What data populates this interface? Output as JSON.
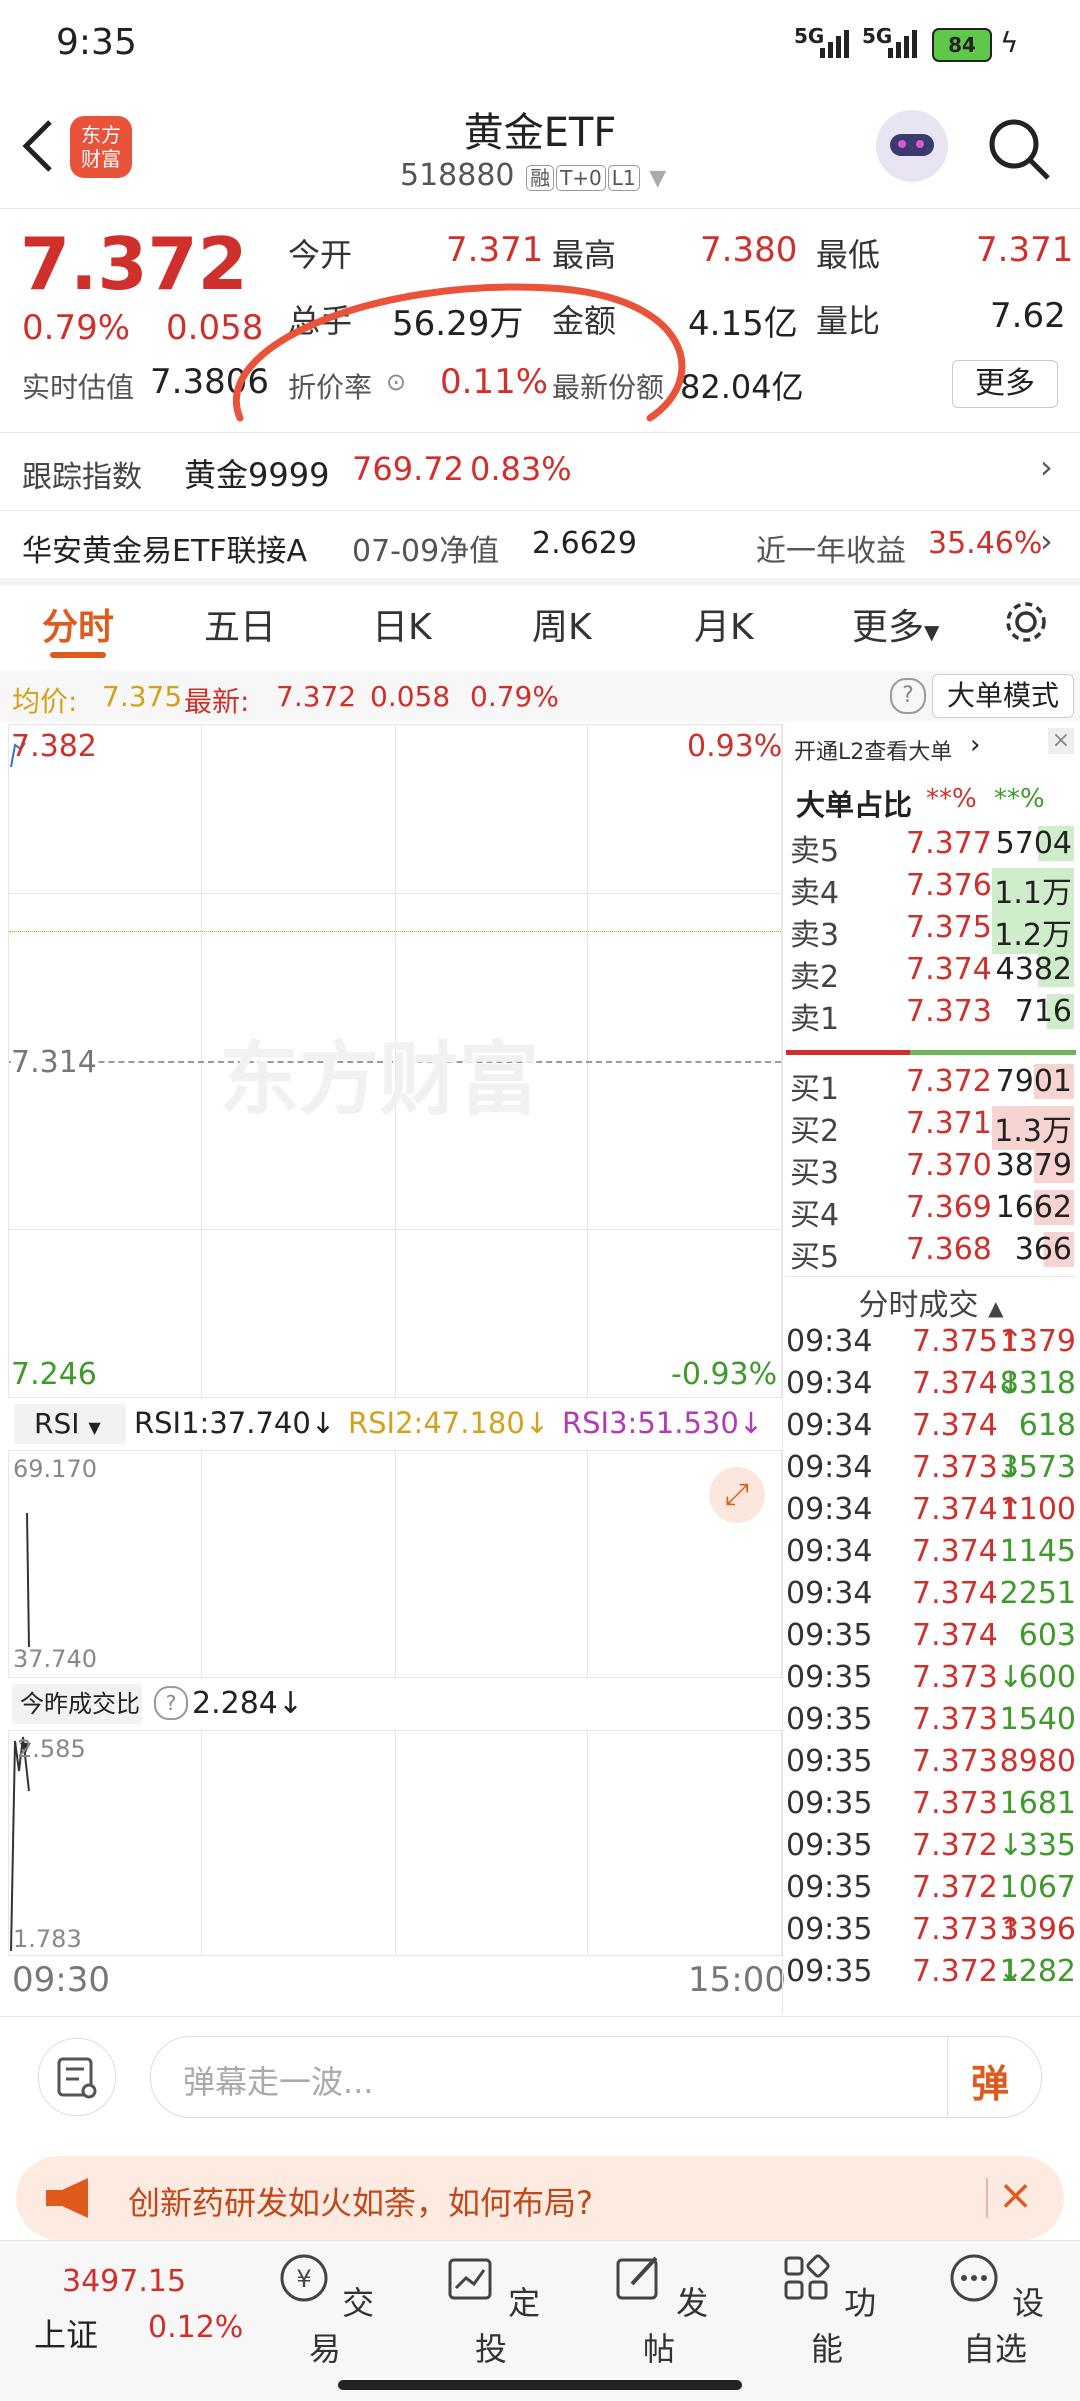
{
  "status_bar": {
    "time": "9:35",
    "network1": "5G",
    "network2": "5G",
    "battery": "84"
  },
  "header": {
    "logo_line1": "东方",
    "logo_line2": "财富",
    "title": "黄金ETF",
    "code": "518880",
    "tags": [
      "融",
      "T+0",
      "L1"
    ]
  },
  "quote": {
    "price": "7.372",
    "change_pct": "0.79%",
    "change": "0.058",
    "open_label": "今开",
    "open": "7.371",
    "high_label": "最高",
    "high": "7.380",
    "low_label": "最低",
    "low": "7.371",
    "volume_label": "总手",
    "volume": "56.29万",
    "amount_label": "金额",
    "amount": "4.15亿",
    "vol_ratio_label": "量比",
    "vol_ratio": "7.62",
    "est_label": "实时估值",
    "est": "7.3806",
    "discount_label": "折价率",
    "discount": "0.11%",
    "shares_label": "最新份额",
    "shares": "82.04亿",
    "more": "更多"
  },
  "tracking": {
    "label": "跟踪指数",
    "name": "黄金9999",
    "value": "769.72",
    "pct": "0.83%"
  },
  "linked": {
    "name": "华安黄金易ETF联接A",
    "date_label": "07-09净值",
    "nav": "2.6629",
    "yr_label": "近一年收益",
    "yr": "35.46%"
  },
  "tabs": [
    "分时",
    "五日",
    "日K",
    "周K",
    "月K",
    "更多"
  ],
  "chart_header": {
    "avg_label": "均价:",
    "avg": "7.375",
    "latest_label": "最新:",
    "latest": "7.372",
    "chg": "0.058",
    "pct": "0.79%",
    "mode": "大单模式"
  },
  "chart": {
    "y_top": "7.382",
    "y_mid": "7.314",
    "y_bot": "7.246",
    "pct_top": "0.93%",
    "pct_bot": "-0.93%",
    "watermark": "东方财富",
    "x_start": "09:30",
    "x_end": "15:00"
  },
  "rsi": {
    "selector": "RSI",
    "rsi1": "RSI1:37.740",
    "rsi2": "RSI2:47.180",
    "rsi3": "RSI3:51.530",
    "y_top": "69.170",
    "y_bot": "37.740"
  },
  "volratio": {
    "selector": "今昨成交比",
    "value": "2.284",
    "y_top": "2.585",
    "y_bot": "1.783"
  },
  "orderbook": {
    "l2_promo": "开通L2查看大单",
    "big_label": "大单占比",
    "big1": "**%",
    "big2": "**%",
    "asks": [
      {
        "label": "卖5",
        "price": "7.377",
        "vol": "5704"
      },
      {
        "label": "卖4",
        "price": "7.376",
        "vol": "1.1万"
      },
      {
        "label": "卖3",
        "price": "7.375",
        "vol": "1.2万"
      },
      {
        "label": "卖2",
        "price": "7.374",
        "vol": "4382"
      },
      {
        "label": "卖1",
        "price": "7.373",
        "vol": "716"
      }
    ],
    "bids": [
      {
        "label": "买1",
        "price": "7.372",
        "vol": "7901"
      },
      {
        "label": "买2",
        "price": "7.371",
        "vol": "1.3万"
      },
      {
        "label": "买3",
        "price": "7.370",
        "vol": "3879"
      },
      {
        "label": "买4",
        "price": "7.369",
        "vol": "1662"
      },
      {
        "label": "买5",
        "price": "7.368",
        "vol": "366"
      }
    ],
    "trades_label": "分时成交",
    "trades": [
      {
        "t": "09:34",
        "p": "7.375",
        "d": "↑",
        "v": "1379"
      },
      {
        "t": "09:34",
        "p": "7.374",
        "d": "↓",
        "v": "8318"
      },
      {
        "t": "09:34",
        "p": "7.374",
        "d": "",
        "v": "618"
      },
      {
        "t": "09:34",
        "p": "7.373",
        "d": "↓",
        "v": "3573"
      },
      {
        "t": "09:34",
        "p": "7.374",
        "d": "↑",
        "v": "1100"
      },
      {
        "t": "09:34",
        "p": "7.374",
        "d": "",
        "v": "1145"
      },
      {
        "t": "09:34",
        "p": "7.374",
        "d": "",
        "v": "2251"
      },
      {
        "t": "09:35",
        "p": "7.374",
        "d": "",
        "v": "603"
      },
      {
        "t": "09:35",
        "p": "7.373",
        "d": "↓",
        "v": "600"
      },
      {
        "t": "09:35",
        "p": "7.373",
        "d": "",
        "v": "1540"
      },
      {
        "t": "09:35",
        "p": "7.373",
        "d": "",
        "v": "8980"
      },
      {
        "t": "09:35",
        "p": "7.373",
        "d": "",
        "v": "1681"
      },
      {
        "t": "09:35",
        "p": "7.372",
        "d": "↓",
        "v": "335"
      },
      {
        "t": "09:35",
        "p": "7.372",
        "d": "",
        "v": "1067"
      },
      {
        "t": "09:35",
        "p": "7.373",
        "d": "↑",
        "v": "3396"
      },
      {
        "t": "09:35",
        "p": "7.372",
        "d": "↓",
        "v": "1282"
      }
    ]
  },
  "danmu": {
    "placeholder": "弹幕走一波...",
    "btn": "弹"
  },
  "banner": {
    "text": "创新药研发如火如荼，如何布局?"
  },
  "bottom_nav": {
    "index_value": "3497.15",
    "index_name": "上证",
    "index_pct": "0.12%",
    "items": [
      "交易",
      "定投",
      "发帖",
      "功能",
      "设自选"
    ]
  },
  "colors": {
    "up": "#d0302b",
    "down": "#3f9a2c",
    "accent": "#e05a1e"
  }
}
